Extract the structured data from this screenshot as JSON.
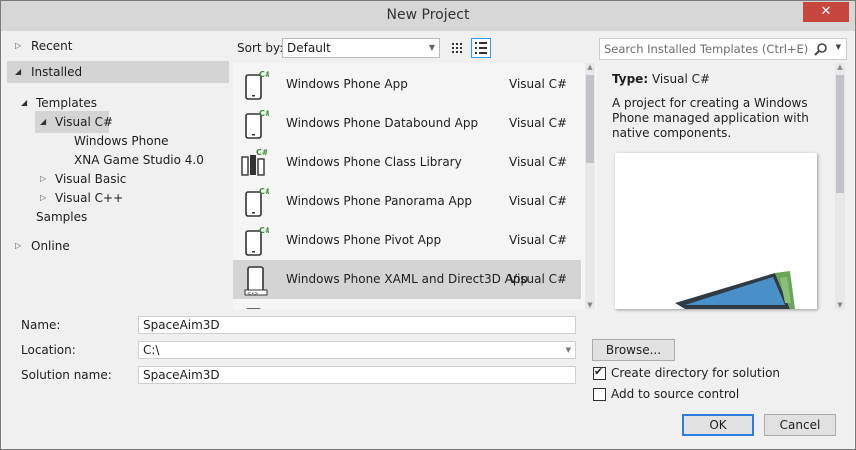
{
  "window": {
    "title": "New Project",
    "close_glyph": "✕"
  },
  "nav": {
    "recent": "Recent",
    "installed": "Installed",
    "templates": "Templates",
    "visual_csharp": "Visual C#",
    "windows_phone": "Windows Phone",
    "xna": "XNA Game Studio 4.0",
    "visual_basic": "Visual Basic",
    "visual_cpp": "Visual C++",
    "samples": "Samples",
    "online": "Online"
  },
  "sort": {
    "label": "Sort by:",
    "value": "Default"
  },
  "search": {
    "placeholder": "Search Installed Templates (Ctrl+E)"
  },
  "templates": [
    {
      "name": "Windows Phone App",
      "lang": "Visual C#"
    },
    {
      "name": "Windows Phone Databound App",
      "lang": "Visual C#"
    },
    {
      "name": "Windows Phone Class Library",
      "lang": "Visual C#"
    },
    {
      "name": "Windows Phone Panorama App",
      "lang": "Visual C#"
    },
    {
      "name": "Windows Phone Pivot App",
      "lang": "Visual C#"
    },
    {
      "name": "Windows Phone XAML and Direct3D App",
      "lang": "Visual C#",
      "selected": true
    }
  ],
  "details": {
    "type_label": "Type:",
    "type_value": "Visual C#",
    "description": "A project for creating a Windows Phone managed application with native components."
  },
  "form": {
    "name_label": "Name:",
    "name_value": "SpaceAim3D",
    "location_label": "Location:",
    "location_value": "C:\\",
    "solution_label": "Solution name:",
    "solution_value": "SpaceAim3D",
    "browse": "Browse...",
    "create_dir": "Create directory for solution",
    "create_dir_checked": true,
    "add_source": "Add to source control",
    "add_source_checked": false,
    "ok": "OK",
    "cancel": "Cancel"
  },
  "colors": {
    "selection": "#d4d4d4",
    "close_button": "#c7463e",
    "accent_border": "#3399ff"
  }
}
